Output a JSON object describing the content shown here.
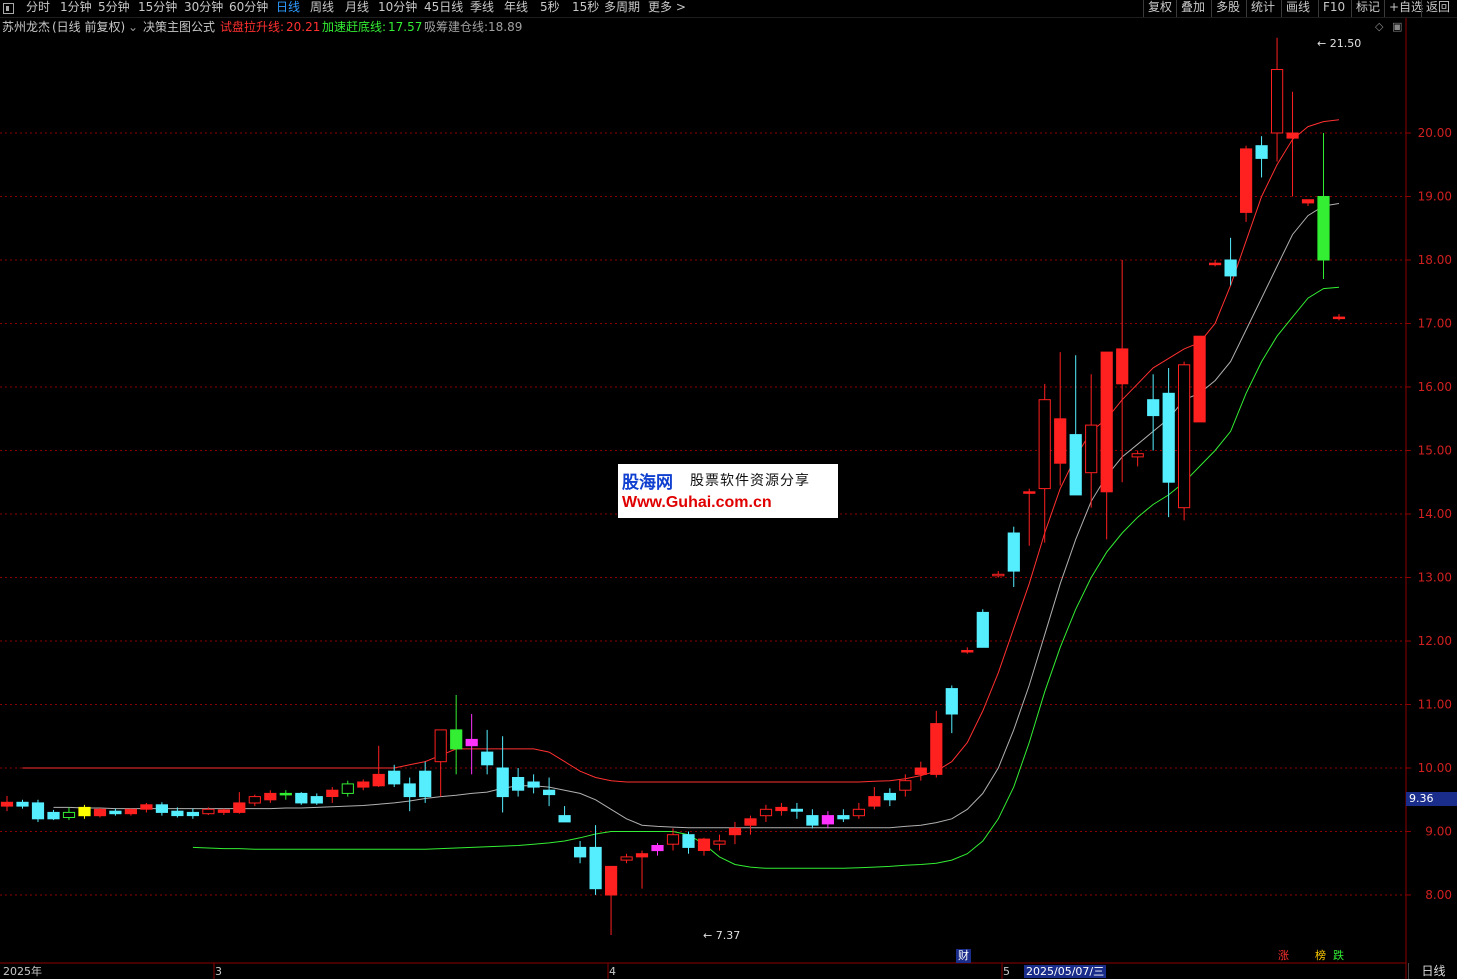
{
  "toolbar": {
    "periods": [
      "分时",
      "1分钟",
      "5分钟",
      "15分钟",
      "30分钟",
      "60分钟",
      "日线",
      "周线",
      "月线",
      "10分钟",
      "45日线",
      "季线",
      "年线",
      "5秒",
      "15秒",
      "多周期",
      "更多 >"
    ],
    "active_period": "日线",
    "right_buttons": [
      "复权",
      "叠加",
      "多股",
      "统计",
      "画线",
      "F10",
      "标记",
      "+自选",
      "返回"
    ]
  },
  "legend": {
    "stock_name": "苏州龙杰",
    "mode": "(日线 前复权)",
    "formula": "决策主图公式",
    "lines": [
      {
        "name": "试盘拉升线:",
        "value": "20.21",
        "color": "#ff3030"
      },
      {
        "name": "加速赶底线:",
        "value": "17.57",
        "color": "#33ee33"
      },
      {
        "name": "吸筹建仓线:",
        "value": "18.89",
        "color": "#a0a0a0"
      }
    ]
  },
  "price_axis": {
    "ticks": [
      "20.00",
      "19.00",
      "18.00",
      "17.00",
      "16.00",
      "15.00",
      "14.00",
      "13.00",
      "12.00",
      "11.00",
      "10.00",
      "9.00",
      "8.00"
    ],
    "current_price": "9.36"
  },
  "annotations": {
    "high": "21.50",
    "low": "7.37"
  },
  "markers": [
    {
      "text": "财",
      "color": "#ffffff",
      "bg": "#1a2d8a"
    },
    {
      "text": "涨",
      "color": "#ff3030"
    },
    {
      "text": "榜",
      "color": "#ffcc00"
    },
    {
      "text": "跌",
      "color": "#33ee33"
    }
  ],
  "date_axis": {
    "labels": [
      "2025年",
      "3",
      "4",
      "5"
    ],
    "highlight": "2025/05/07/三",
    "period_label": "日线"
  },
  "watermark": {
    "logo": "股海网",
    "tagline": "股票软件资源分享",
    "url": "Www.Guhai.com.cn"
  },
  "colors": {
    "up": "#ff2020",
    "down": "#55eeff",
    "upper_line": "#ff3030",
    "middle_line": "#b0b0b0",
    "lower_line": "#33ee33",
    "grid": "#8b0000"
  },
  "chart_data": {
    "type": "candlestick",
    "series": [
      {
        "o": 9.4,
        "h": 9.56,
        "l": 9.32,
        "c": 9.46
      },
      {
        "o": 9.46,
        "h": 9.5,
        "l": 9.36,
        "c": 9.4
      },
      {
        "o": 9.45,
        "h": 9.5,
        "l": 9.15,
        "c": 9.2
      },
      {
        "o": 9.3,
        "h": 9.34,
        "l": 9.18,
        "c": 9.2
      },
      {
        "o": 9.22,
        "h": 9.38,
        "l": 9.18,
        "c": 9.3
      },
      {
        "o": 9.25,
        "h": 9.42,
        "l": 9.2,
        "c": 9.38
      },
      {
        "o": 9.25,
        "h": 9.37,
        "l": 9.22,
        "c": 9.35
      },
      {
        "o": 9.32,
        "h": 9.36,
        "l": 9.25,
        "c": 9.28
      },
      {
        "o": 9.28,
        "h": 9.36,
        "l": 9.25,
        "c": 9.35
      },
      {
        "o": 9.35,
        "h": 9.45,
        "l": 9.3,
        "c": 9.42
      },
      {
        "o": 9.42,
        "h": 9.46,
        "l": 9.25,
        "c": 9.3
      },
      {
        "o": 9.32,
        "h": 9.38,
        "l": 9.22,
        "c": 9.25
      },
      {
        "o": 9.3,
        "h": 9.36,
        "l": 9.2,
        "c": 9.25
      },
      {
        "o": 9.28,
        "h": 9.38,
        "l": 9.26,
        "c": 9.35
      },
      {
        "o": 9.3,
        "h": 9.36,
        "l": 9.26,
        "c": 9.34
      },
      {
        "o": 9.3,
        "h": 9.62,
        "l": 9.28,
        "c": 9.45
      },
      {
        "o": 9.45,
        "h": 9.58,
        "l": 9.4,
        "c": 9.55
      },
      {
        "o": 9.5,
        "h": 9.65,
        "l": 9.45,
        "c": 9.6
      },
      {
        "o": 9.58,
        "h": 9.65,
        "l": 9.5,
        "c": 9.6
      },
      {
        "o": 9.6,
        "h": 9.62,
        "l": 9.42,
        "c": 9.45
      },
      {
        "o": 9.55,
        "h": 9.6,
        "l": 9.42,
        "c": 9.45
      },
      {
        "o": 9.55,
        "h": 9.7,
        "l": 9.45,
        "c": 9.65
      },
      {
        "o": 9.6,
        "h": 9.8,
        "l": 9.55,
        "c": 9.75
      },
      {
        "o": 9.7,
        "h": 9.82,
        "l": 9.65,
        "c": 9.78
      },
      {
        "o": 9.72,
        "h": 10.35,
        "l": 9.7,
        "c": 9.9
      },
      {
        "o": 9.95,
        "h": 10.05,
        "l": 9.7,
        "c": 9.75
      },
      {
        "o": 9.75,
        "h": 9.85,
        "l": 9.32,
        "c": 9.55
      },
      {
        "o": 9.95,
        "h": 10.1,
        "l": 9.45,
        "c": 9.55
      },
      {
        "o": 10.1,
        "h": 10.4,
        "l": 9.55,
        "c": 10.6
      },
      {
        "o": 10.3,
        "h": 11.15,
        "l": 9.9,
        "c": 10.6
      },
      {
        "o": 10.35,
        "h": 10.85,
        "l": 9.9,
        "c": 10.45
      },
      {
        "o": 10.25,
        "h": 10.6,
        "l": 9.9,
        "c": 10.05
      },
      {
        "o": 10.0,
        "h": 10.5,
        "l": 9.3,
        "c": 9.55
      },
      {
        "o": 9.85,
        "h": 10.0,
        "l": 9.55,
        "c": 9.65
      },
      {
        "o": 9.78,
        "h": 9.9,
        "l": 9.6,
        "c": 9.7
      },
      {
        "o": 9.65,
        "h": 9.85,
        "l": 9.4,
        "c": 9.58
      },
      {
        "o": 9.25,
        "h": 9.4,
        "l": 9.2,
        "c": 9.15
      },
      {
        "o": 8.75,
        "h": 8.85,
        "l": 8.5,
        "c": 8.6
      },
      {
        "o": 8.75,
        "h": 9.1,
        "l": 8.0,
        "c": 8.1
      },
      {
        "o": 8.0,
        "h": 8.45,
        "l": 7.37,
        "c": 8.45
      },
      {
        "o": 8.55,
        "h": 8.65,
        "l": 8.5,
        "c": 8.6
      },
      {
        "o": 8.6,
        "h": 8.7,
        "l": 8.1,
        "c": 8.65
      },
      {
        "o": 8.7,
        "h": 8.82,
        "l": 8.62,
        "c": 8.78
      },
      {
        "o": 8.8,
        "h": 9.05,
        "l": 8.7,
        "c": 8.95
      },
      {
        "o": 8.95,
        "h": 9.0,
        "l": 8.65,
        "c": 8.75
      },
      {
        "o": 8.7,
        "h": 8.9,
        "l": 8.62,
        "c": 8.88
      },
      {
        "o": 8.8,
        "h": 8.95,
        "l": 8.7,
        "c": 8.85
      },
      {
        "o": 8.95,
        "h": 9.15,
        "l": 8.8,
        "c": 9.05
      },
      {
        "o": 9.1,
        "h": 9.25,
        "l": 8.95,
        "c": 9.2
      },
      {
        "o": 9.25,
        "h": 9.42,
        "l": 9.15,
        "c": 9.35
      },
      {
        "o": 9.33,
        "h": 9.45,
        "l": 9.25,
        "c": 9.38
      },
      {
        "o": 9.35,
        "h": 9.45,
        "l": 9.2,
        "c": 9.32
      },
      {
        "o": 9.25,
        "h": 9.35,
        "l": 9.05,
        "c": 9.1
      },
      {
        "o": 9.25,
        "h": 9.32,
        "l": 9.05,
        "c": 9.12
      },
      {
        "o": 9.25,
        "h": 9.35,
        "l": 9.15,
        "c": 9.2
      },
      {
        "o": 9.25,
        "h": 9.45,
        "l": 9.2,
        "c": 9.35
      },
      {
        "o": 9.4,
        "h": 9.7,
        "l": 9.35,
        "c": 9.55
      },
      {
        "o": 9.6,
        "h": 9.68,
        "l": 9.4,
        "c": 9.5
      },
      {
        "o": 9.65,
        "h": 9.9,
        "l": 9.55,
        "c": 9.8
      },
      {
        "o": 9.9,
        "h": 10.1,
        "l": 9.8,
        "c": 10.0
      },
      {
        "o": 9.9,
        "h": 10.9,
        "l": 9.85,
        "c": 10.7
      },
      {
        "o": 11.25,
        "h": 11.3,
        "l": 10.55,
        "c": 10.85
      },
      {
        "o": 11.85,
        "h": 11.9,
        "l": 11.8,
        "c": 11.85
      },
      {
        "o": 12.45,
        "h": 12.5,
        "l": 11.95,
        "c": 11.9
      },
      {
        "o": 13.05,
        "h": 13.1,
        "l": 13.0,
        "c": 13.05
      },
      {
        "o": 13.7,
        "h": 13.8,
        "l": 12.85,
        "c": 13.1
      },
      {
        "o": 14.35,
        "h": 14.4,
        "l": 13.5,
        "c": 14.35
      },
      {
        "o": 14.4,
        "h": 16.05,
        "l": 13.55,
        "c": 15.8
      },
      {
        "o": 14.8,
        "h": 16.55,
        "l": 14.45,
        "c": 15.5
      },
      {
        "o": 15.25,
        "h": 16.5,
        "l": 14.6,
        "c": 14.3
      },
      {
        "o": 14.65,
        "h": 16.2,
        "l": 14.1,
        "c": 15.4
      },
      {
        "o": 14.35,
        "h": 16.55,
        "l": 13.6,
        "c": 16.55
      },
      {
        "o": 16.05,
        "h": 18.0,
        "l": 14.5,
        "c": 16.6
      },
      {
        "o": 14.9,
        "h": 15.0,
        "l": 14.75,
        "c": 14.95
      },
      {
        "o": 15.8,
        "h": 16.2,
        "l": 15.0,
        "c": 15.55
      },
      {
        "o": 15.9,
        "h": 16.3,
        "l": 13.95,
        "c": 14.5
      },
      {
        "o": 14.1,
        "h": 16.4,
        "l": 13.9,
        "c": 16.35
      },
      {
        "o": 15.45,
        "h": 16.3,
        "l": 15.6,
        "c": 16.8
      },
      {
        "o": 17.95,
        "h": 18.0,
        "l": 17.9,
        "c": 17.95
      },
      {
        "o": 18.0,
        "h": 18.35,
        "l": 17.6,
        "c": 17.75
      },
      {
        "o": 18.75,
        "h": 19.8,
        "l": 18.6,
        "c": 19.75
      },
      {
        "o": 19.8,
        "h": 19.95,
        "l": 19.3,
        "c": 19.6
      },
      {
        "o": 20.0,
        "h": 21.5,
        "l": 19.55,
        "c": 21.0
      },
      {
        "o": 19.92,
        "h": 20.65,
        "l": 19.0,
        "c": 20.0
      },
      {
        "o": 18.9,
        "h": 18.95,
        "l": 18.85,
        "c": 18.95
      },
      {
        "o": 19.0,
        "h": 20.0,
        "l": 17.7,
        "c": 18.0
      },
      {
        "o": 17.1,
        "h": 17.15,
        "l": 17.05,
        "c": 17.1
      }
    ],
    "lines": {
      "upper": [
        10.0,
        10.0,
        10.0,
        10.0,
        10.0,
        10.0,
        10.0,
        10.0,
        10.0,
        10.0,
        10.0,
        10.0,
        10.0,
        10.0,
        10.0,
        10.0,
        10.0,
        10.0,
        10.0,
        10.0,
        10.0,
        10.0,
        10.0,
        10.0,
        10.0,
        10.05,
        10.1,
        10.2,
        10.3,
        10.3,
        10.3,
        10.3,
        10.3,
        10.3,
        10.25,
        10.1,
        9.95,
        9.85,
        9.8,
        9.78,
        9.78,
        9.78,
        9.78,
        9.78,
        9.78,
        9.78,
        9.78,
        9.78,
        9.78,
        9.78,
        9.78,
        9.78,
        9.78,
        9.78,
        9.78,
        9.79,
        9.8,
        9.83,
        9.88,
        9.95,
        10.1,
        10.4,
        10.9,
        11.5,
        12.2,
        12.9,
        13.7,
        14.4,
        14.9,
        15.3,
        15.5,
        15.8,
        16.05,
        16.3,
        16.45,
        16.6,
        16.7,
        17.0,
        17.6,
        18.3,
        19.0,
        19.5,
        19.9,
        20.1,
        20.18,
        20.21
      ],
      "middle": [
        9.38,
        9.38,
        9.37,
        9.37,
        9.36,
        9.36,
        9.36,
        9.36,
        9.36,
        9.36,
        9.36,
        9.36,
        9.36,
        9.36,
        9.36,
        9.37,
        9.37,
        9.38,
        9.39,
        9.4,
        9.41,
        9.43,
        9.45,
        9.48,
        9.52,
        9.55,
        9.57,
        9.6,
        9.62,
        9.68,
        9.72,
        9.72,
        9.7,
        9.65,
        9.6,
        9.5,
        9.35,
        9.2,
        9.1,
        9.08,
        9.07,
        9.06,
        9.06,
        9.06,
        9.06,
        9.06,
        9.06,
        9.06,
        9.06,
        9.06,
        9.06,
        9.06,
        9.06,
        9.06,
        9.06,
        9.08,
        9.1,
        9.14,
        9.2,
        9.35,
        9.6,
        10.0,
        10.6,
        11.3,
        12.1,
        12.9,
        13.6,
        14.2,
        14.6,
        14.9,
        15.1,
        15.3,
        15.5,
        15.8,
        15.9,
        16.1,
        16.4,
        16.9,
        17.4,
        17.9,
        18.4,
        18.7,
        18.85,
        18.89
      ],
      "lower": [
        8.75,
        8.74,
        8.73,
        8.73,
        8.72,
        8.72,
        8.72,
        8.72,
        8.72,
        8.72,
        8.72,
        8.72,
        8.72,
        8.72,
        8.72,
        8.72,
        8.73,
        8.74,
        8.75,
        8.76,
        8.77,
        8.78,
        8.8,
        8.82,
        8.85,
        8.9,
        8.96,
        9.0,
        9.0,
        9.0,
        9.0,
        9.0,
        8.95,
        8.8,
        8.6,
        8.48,
        8.44,
        8.42,
        8.42,
        8.42,
        8.42,
        8.42,
        8.42,
        8.43,
        8.44,
        8.45,
        8.47,
        8.48,
        8.5,
        8.55,
        8.65,
        8.85,
        9.2,
        9.7,
        10.4,
        11.2,
        11.9,
        12.5,
        13.0,
        13.4,
        13.7,
        13.95,
        14.15,
        14.3,
        14.5,
        14.75,
        15.0,
        15.3,
        15.9,
        16.4,
        16.8,
        17.1,
        17.4,
        17.55,
        17.57
      ],
      "upper_start_index": 0,
      "middle_start_index": 0,
      "lower_start_index": 0
    },
    "ylim": [
      7.1,
      21.8
    ],
    "grid": true
  }
}
